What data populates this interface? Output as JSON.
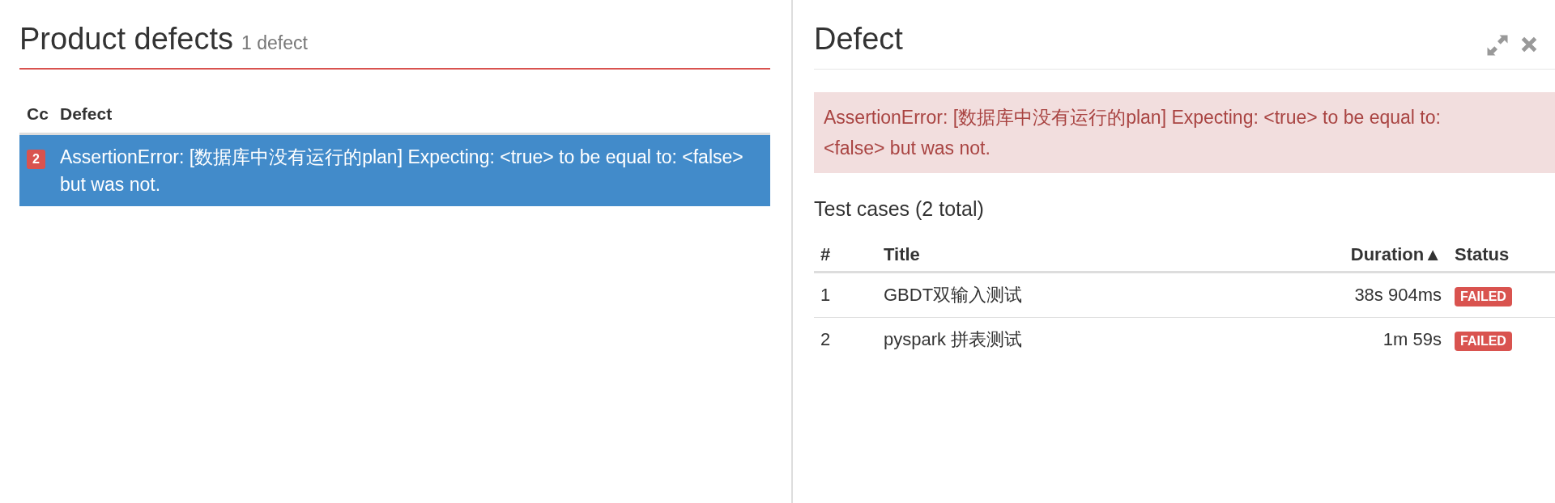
{
  "defects_pane": {
    "title": "Product defects",
    "count": "1 defect",
    "table": {
      "columns": [
        "Cc",
        "Defect"
      ],
      "rows": [
        {
          "count": "2",
          "message": "AssertionError: [数据库中没有运行的plan] Expecting: <true> to be equal to: <false> but was not.",
          "selected": true
        }
      ]
    }
  },
  "detail_pane": {
    "title": "Defect",
    "message": "AssertionError: [数据库中没有运行的plan] Expecting: <true> to be equal to: <false> but was not.",
    "test_cases": {
      "heading": "Test cases (2 total)",
      "columns": [
        {
          "label": "#"
        },
        {
          "label": "Title"
        },
        {
          "label": "Duration",
          "sort": "▲"
        },
        {
          "label": "Status"
        }
      ],
      "rows": [
        {
          "number": "1",
          "title": "GBDT双输入测试",
          "duration": "38s 904ms",
          "status": "FAILED"
        },
        {
          "number": "2",
          "title": "pyspark 拼表测试",
          "duration": "1m 59s",
          "status": "FAILED"
        }
      ]
    }
  }
}
